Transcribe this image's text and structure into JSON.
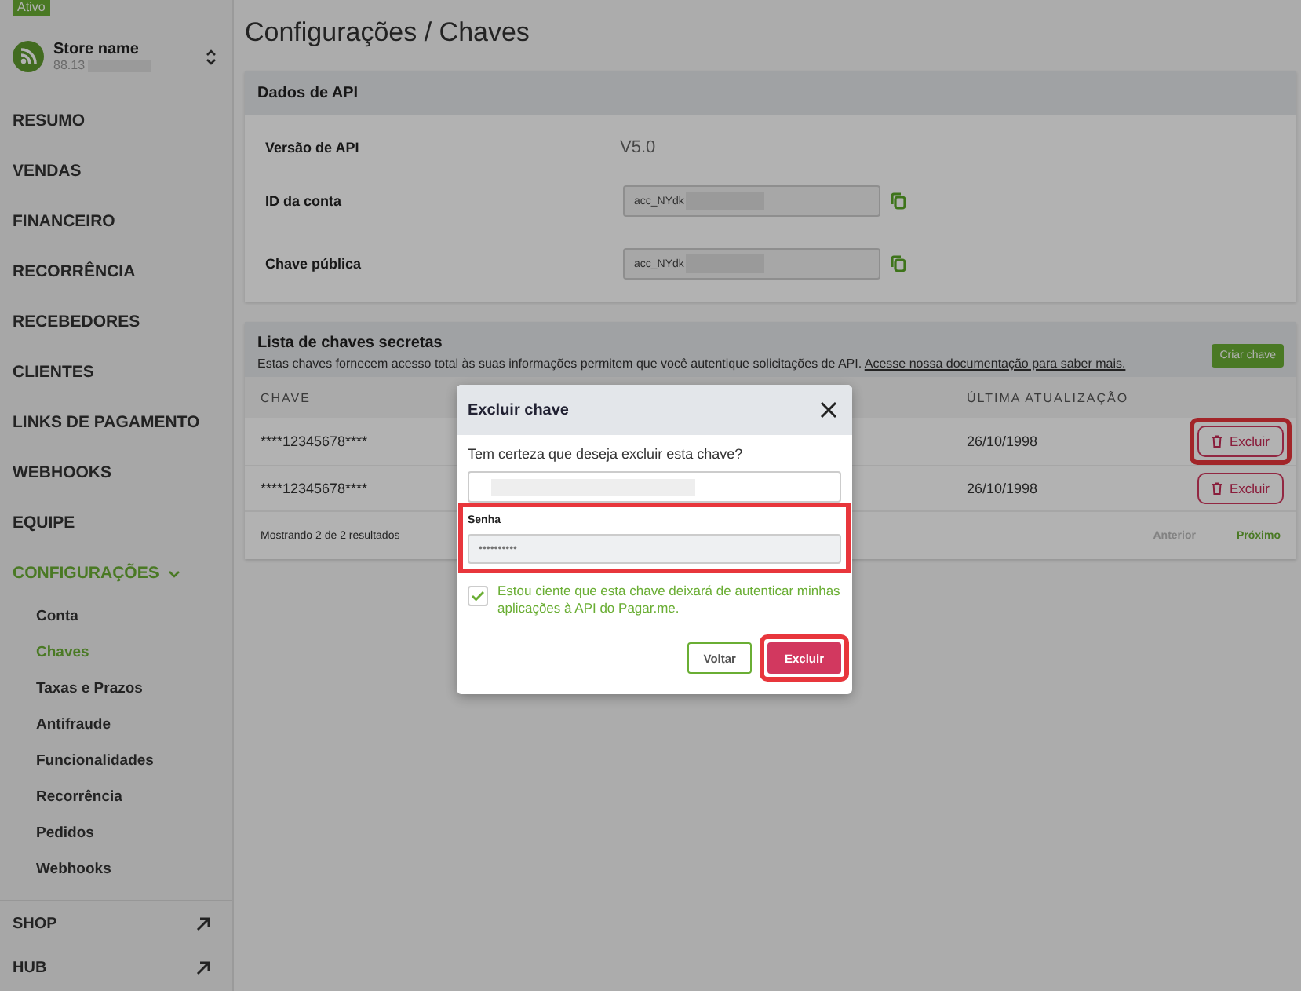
{
  "sidebar": {
    "badge": "Ativo",
    "store": {
      "name": "Store name",
      "subtitle": "88.13"
    },
    "items": [
      {
        "label": "RESUMO",
        "selected": false
      },
      {
        "label": "VENDAS",
        "selected": false
      },
      {
        "label": "FINANCEIRO",
        "selected": false
      },
      {
        "label": "RECORRÊNCIA",
        "selected": false
      },
      {
        "label": "RECEBEDORES",
        "selected": false
      },
      {
        "label": "CLIENTES",
        "selected": false
      },
      {
        "label": "LINKS DE PAGAMENTO",
        "selected": false
      },
      {
        "label": "WEBHOOKS",
        "selected": false
      },
      {
        "label": "EQUIPE",
        "selected": false
      },
      {
        "label": "CONFIGURAÇÕES",
        "selected": true,
        "expanded": true,
        "children": [
          {
            "label": "Conta",
            "selected": false
          },
          {
            "label": "Chaves",
            "selected": true
          },
          {
            "label": "Taxas e Prazos",
            "selected": false
          },
          {
            "label": "Antifraude",
            "selected": false
          },
          {
            "label": "Funcionalidades",
            "selected": false
          },
          {
            "label": "Recorrência",
            "selected": false
          },
          {
            "label": "Pedidos",
            "selected": false
          },
          {
            "label": "Webhooks",
            "selected": false
          }
        ]
      }
    ],
    "footer_items": [
      {
        "label": "SHOP"
      },
      {
        "label": "HUB"
      }
    ]
  },
  "page_title": "Configurações / Chaves",
  "api_card": {
    "title": "Dados de API",
    "rows": [
      {
        "kind": "text",
        "label": "Versão de API",
        "value": "V5.0"
      },
      {
        "kind": "copy_field",
        "label": "ID da conta",
        "value": "acc_NYdk"
      },
      {
        "kind": "copy_field",
        "label": "Chave pública",
        "value": "acc_NYdk"
      }
    ]
  },
  "keys_card": {
    "title": "Lista de chaves secretas",
    "description": "Estas chaves fornecem acesso total às suas informações permitem que você autentique solicitações de API.",
    "link": "Acesse nossa documentação para saber mais.",
    "create_button": "Criar chave",
    "columns": [
      "CHAVE",
      "ÚLTIMA ATUALIZAÇÃO"
    ],
    "rows": [
      {
        "key": "****12345678****",
        "updated": "26/10/1998",
        "action": "Excluir",
        "highlighted": true
      },
      {
        "key": "****12345678****",
        "updated": "26/10/1998",
        "action": "Excluir",
        "highlighted": false
      }
    ],
    "footer": {
      "summary": "Mostrando 2 de 2 resultados",
      "prev": {
        "label": "Anterior",
        "disabled": true
      },
      "next": {
        "label": "Próximo",
        "disabled": false
      }
    }
  },
  "modal": {
    "title": "Excluir chave",
    "question": "Tem certeza que deseja excluir esta chave?",
    "password_label": "Senha",
    "password_placeholder": "••••••••••",
    "password_highlighted": true,
    "consent": {
      "checked": true,
      "text": "Estou ciente que esta chave deixará de autenticar minhas aplicações à API do Pagar.me."
    },
    "buttons": [
      {
        "label": "Voltar",
        "kind": "secondary",
        "highlighted": false
      },
      {
        "label": "Excluir",
        "kind": "primary",
        "highlighted": true
      }
    ]
  }
}
